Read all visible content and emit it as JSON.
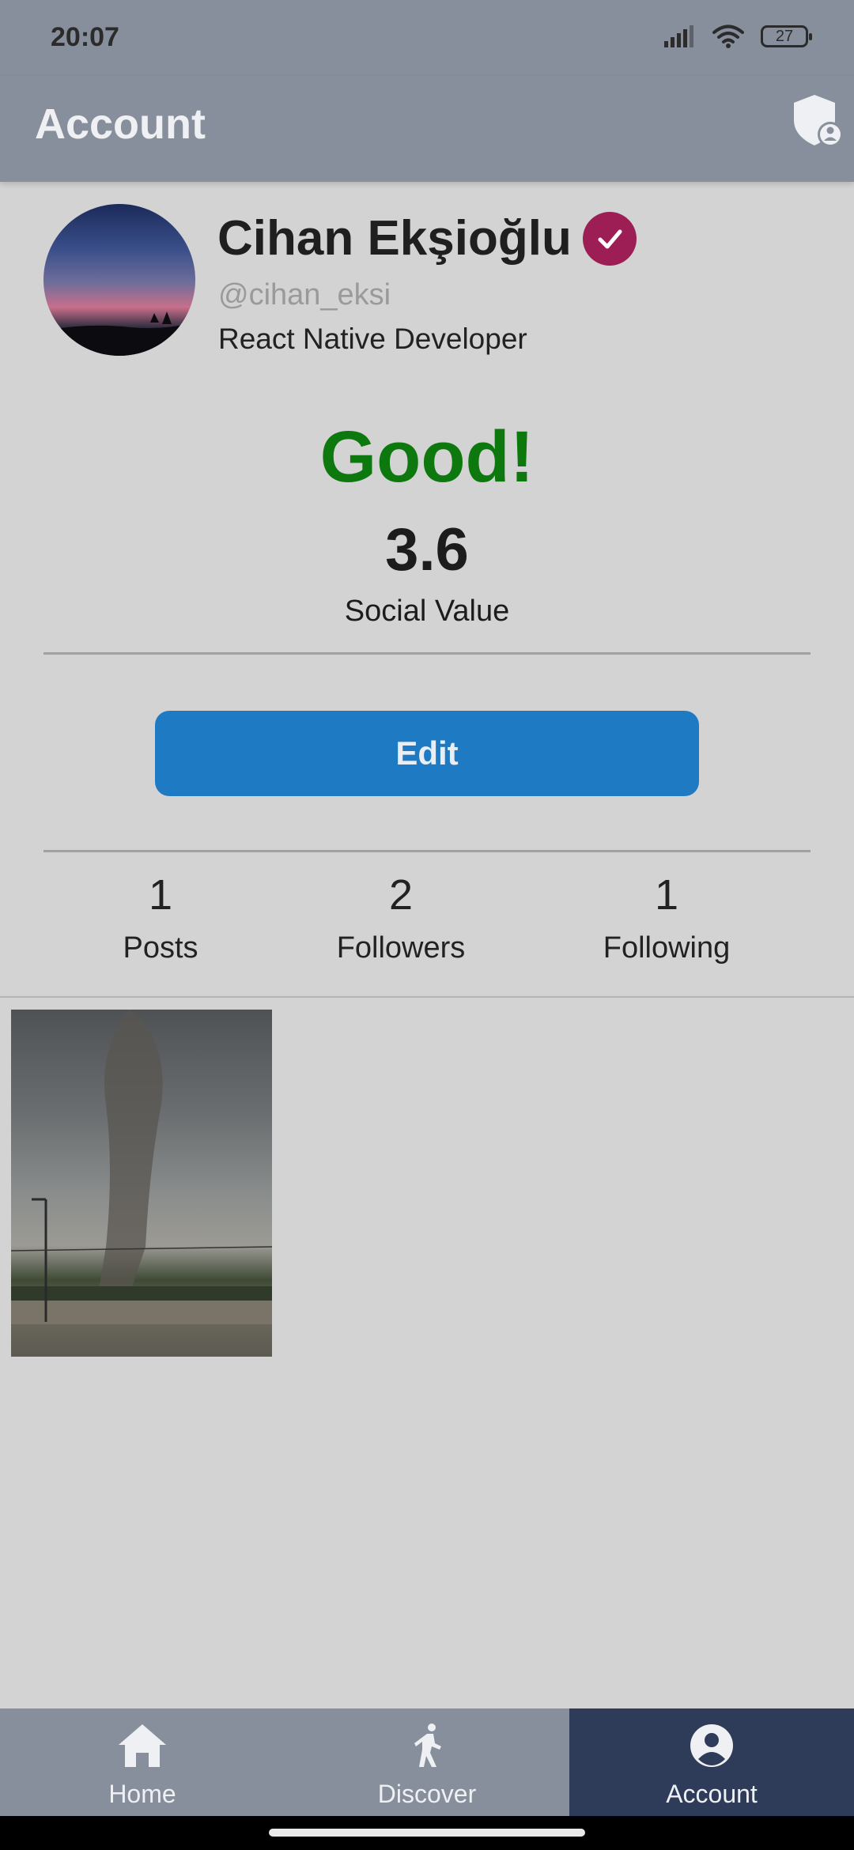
{
  "status_bar": {
    "time": "20:07",
    "battery": "27"
  },
  "header": {
    "title": "Account",
    "action_icon": "shield-user-icon"
  },
  "profile": {
    "name": "Cihan Ekşioğlu",
    "handle": "@cihan_eksi",
    "bio": "React Native Developer",
    "verified_color": "#9c1e55"
  },
  "rating": {
    "label": "Good!",
    "value": "3.6",
    "caption": "Social Value",
    "label_color": "#0d780d"
  },
  "edit_button": {
    "label": "Edit",
    "color": "#1f7ac4"
  },
  "stats": [
    {
      "value": "1",
      "label": "Posts"
    },
    {
      "value": "2",
      "label": "Followers"
    },
    {
      "value": "1",
      "label": "Following"
    }
  ],
  "posts": [
    {
      "thumbnail": "tornado-photo"
    }
  ],
  "bottom_nav": {
    "active": "Account",
    "items": [
      {
        "label": "Home",
        "icon": "home-icon"
      },
      {
        "label": "Discover",
        "icon": "walking-person-icon"
      },
      {
        "label": "Account",
        "icon": "account-circle-icon"
      }
    ]
  }
}
